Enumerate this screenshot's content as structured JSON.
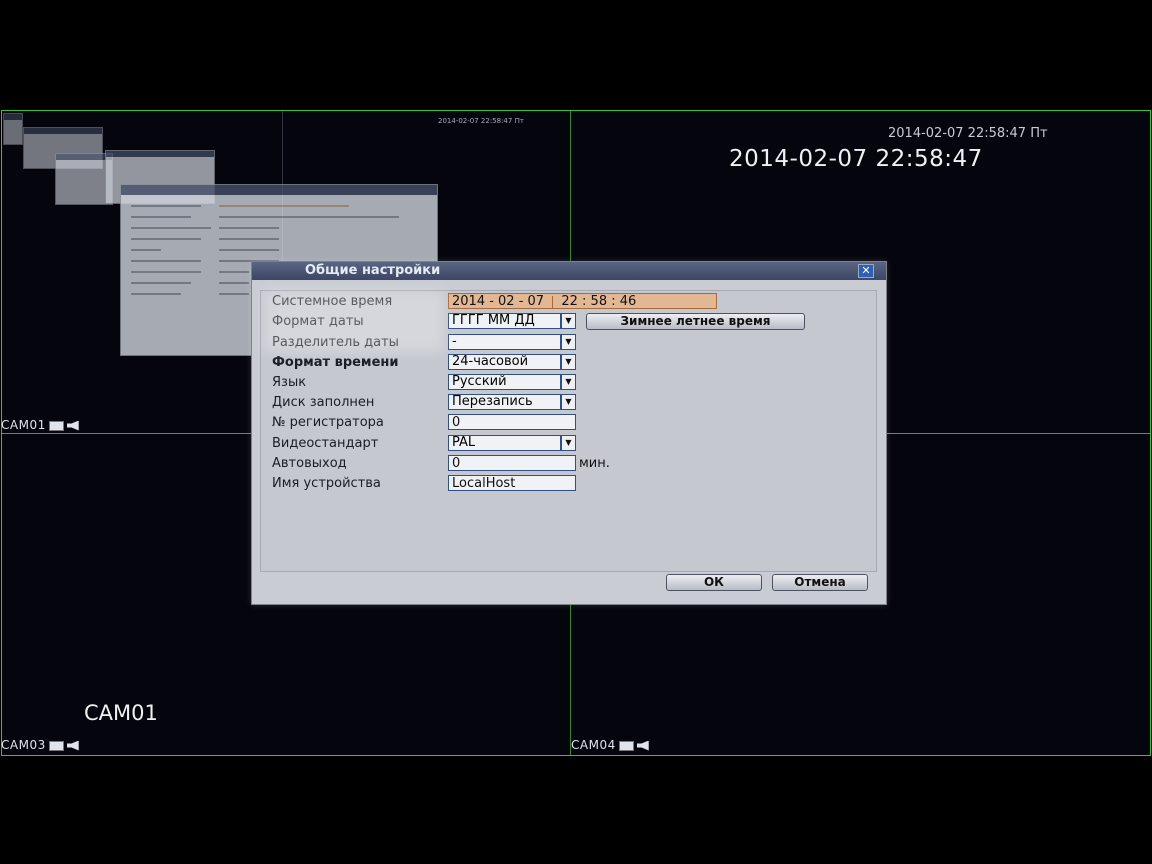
{
  "osd": {
    "small_timestamp": "2014-02-07 22:58:47 Пт",
    "big_timestamp": "2014-02-07 22:58:47",
    "cam_overlay": "CAM01",
    "ghost_timestamp": "2014-02-07 22:58:47 Пт"
  },
  "cameras": [
    {
      "label": "CAM01"
    },
    {
      "label": "CAM03"
    },
    {
      "label": "CAM04"
    }
  ],
  "dialog": {
    "title": "Общие настройки",
    "close_symbol": "✕",
    "fields": {
      "system_time": {
        "label": "Системное время",
        "date": "2014 - 02 - 07",
        "time": "22 : 58 : 46"
      },
      "date_format": {
        "label": "Формат даты",
        "value": "ГГГГ ММ ДД"
      },
      "dst_button": "Зимнее летнее время",
      "date_separator": {
        "label": "Разделитель даты",
        "value": "-"
      },
      "time_format": {
        "label": "Формат времени",
        "value": "24-часовой"
      },
      "language": {
        "label": "Язык",
        "value": "Русский"
      },
      "disk_full": {
        "label": "Диск заполнен",
        "value": "Перезапись"
      },
      "dvr_no": {
        "label": "№ регистратора",
        "value": "0"
      },
      "video_standard": {
        "label": "Видеостандарт",
        "value": "PAL"
      },
      "auto_logout": {
        "label": "Автовыход",
        "value": "0",
        "unit": "мин."
      },
      "device_name": {
        "label": "Имя устройства",
        "value": "LocalHost"
      }
    },
    "ok_label": "ОК",
    "cancel_label": "Отмена"
  },
  "icons": {
    "dropdown_arrow": "▼",
    "record": "record-icon",
    "audio": "speaker-icon"
  },
  "colors": {
    "grid_green": "#3fbf3f",
    "title_bar": "#46506a",
    "highlight_field": "#e2b894",
    "field_border": "#2f4f86"
  }
}
